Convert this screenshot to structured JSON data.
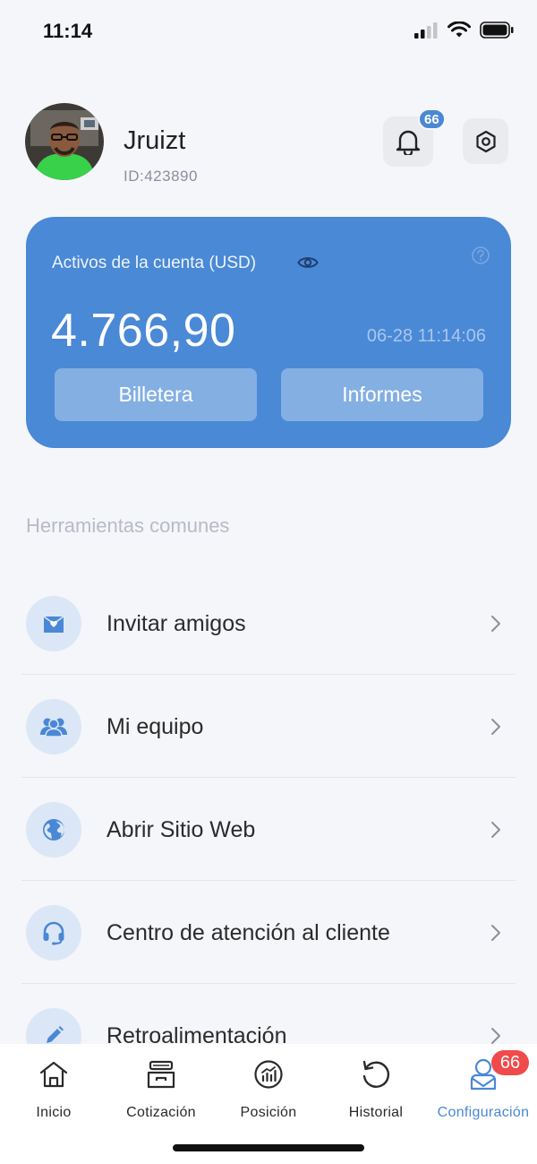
{
  "status_bar": {
    "time": "11:14"
  },
  "profile": {
    "username": "Jruizt",
    "user_id": "ID:423890",
    "notification_count": "66"
  },
  "assets": {
    "label": "Activos de la cuenta (USD)",
    "amount": "4.766,90",
    "timestamp": "06-28 11:14:06",
    "wallet_button": "Billetera",
    "reports_button": "Informes"
  },
  "tools": {
    "title": "Herramientas comunes",
    "items": [
      {
        "label": "Invitar amigos",
        "icon": "invite-icon"
      },
      {
        "label": "Mi equipo",
        "icon": "team-icon"
      },
      {
        "label": "Abrir Sitio Web",
        "icon": "globe-icon"
      },
      {
        "label": "Centro de atención al cliente",
        "icon": "headset-icon"
      },
      {
        "label": "Retroalimentación",
        "icon": "pencil-icon"
      }
    ]
  },
  "tab_bar": {
    "tabs": [
      {
        "label": "Inicio",
        "icon": "home-icon"
      },
      {
        "label": "Cotización",
        "icon": "quote-icon"
      },
      {
        "label": "Posición",
        "icon": "position-icon"
      },
      {
        "label": "Historial",
        "icon": "history-icon"
      },
      {
        "label": "Configuración",
        "icon": "profile-icon",
        "active": true
      }
    ],
    "config_badge": "66"
  },
  "colors": {
    "accent": "#4a88d6",
    "card": "#4a89d6",
    "badge_red": "#f04a4a",
    "background": "#f5f6fa"
  }
}
